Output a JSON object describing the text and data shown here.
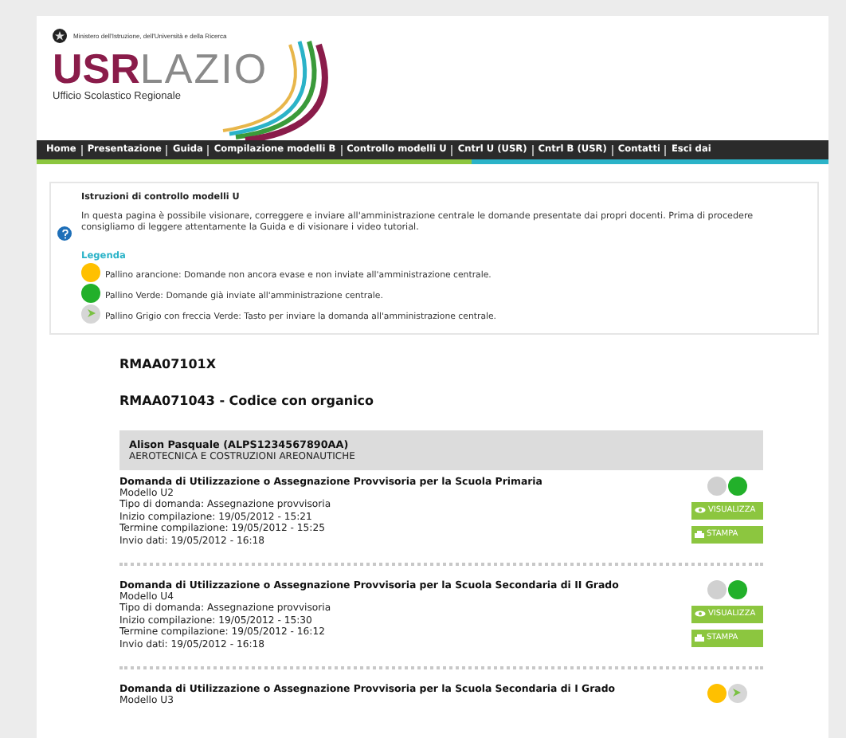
{
  "header": {
    "ministry": "Ministero dell'Istruzione, dell'Università e della Ricerca",
    "logo_bold": "USR",
    "logo_light": "LAZIO",
    "subtitle": "Ufficio Scolastico Regionale"
  },
  "nav": [
    "Home",
    "Presentazione",
    "Guida",
    "Compilazione modelli B",
    "Controllo modelli U",
    "Cntrl U (USR)",
    "Cntrl B (USR)",
    "Contatti",
    "Esci dai"
  ],
  "info": {
    "title": "Istruzioni di controllo modelli U",
    "text": "In questa pagina è possibile visionare, correggere e inviare all'amministrazione centrale le domande presentate dai propri docenti. Prima di procedere consigliamo di leggere attentamente la Guida e di visionare i video tutorial.",
    "legend_title": "Legenda",
    "legend": [
      {
        "kind": "orange",
        "text": "Pallino arancione: Domande non ancora evase e non inviate all'amministrazione centrale."
      },
      {
        "kind": "green",
        "text": "Pallino Verde: Domande già inviate all'amministrazione centrale."
      },
      {
        "kind": "send",
        "text": "Pallino Grigio con freccia Verde: Tasto per inviare la domanda all'amministrazione centrale."
      }
    ]
  },
  "school_code": "RMAA07101X",
  "organico": "RMAA071043 - Codice con organico",
  "person": {
    "name": "Alison Pasquale (ALPS1234567890AA)",
    "subject": "AEROTECNICA E COSTRUZIONI AREONAUTICHE"
  },
  "applications": [
    {
      "title": "Domanda di Utilizzazione o Assegnazione Provvisoria per la Scuola Primaria",
      "lines": [
        "Modello U2",
        "Tipo di domanda: Assegnazione provvisoria",
        "Inizio compilazione: 19/05/2012 - 15:21",
        "Termine compilazione: 19/05/2012 - 15:25",
        "Invio dati: 19/05/2012 - 16:18"
      ],
      "dots": [
        {
          "kind": "grey"
        },
        {
          "kind": "green"
        }
      ],
      "buttons": [
        {
          "kind": "view",
          "label": "VISUALIZZA"
        },
        {
          "kind": "print",
          "label": "STAMPA"
        }
      ]
    },
    {
      "title": "Domanda di Utilizzazione o Assegnazione Provvisoria per la Scuola Secondaria di II Grado",
      "lines": [
        "Modello U4",
        "Tipo di domanda: Assegnazione provvisoria",
        "Inizio compilazione: 19/05/2012 - 15:30",
        "Termine compilazione: 19/05/2012 - 16:12",
        "Invio dati: 19/05/2012 - 16:18"
      ],
      "dots": [
        {
          "kind": "grey"
        },
        {
          "kind": "green"
        }
      ],
      "buttons": [
        {
          "kind": "view",
          "label": "VISUALIZZA"
        },
        {
          "kind": "print",
          "label": "STAMPA"
        }
      ]
    },
    {
      "title": "Domanda di Utilizzazione o Assegnazione Provvisoria per la Scuola Secondaria di I Grado",
      "lines": [
        "Modello U3"
      ],
      "dots": [
        {
          "kind": "orange"
        },
        {
          "kind": "send"
        }
      ]
    }
  ]
}
